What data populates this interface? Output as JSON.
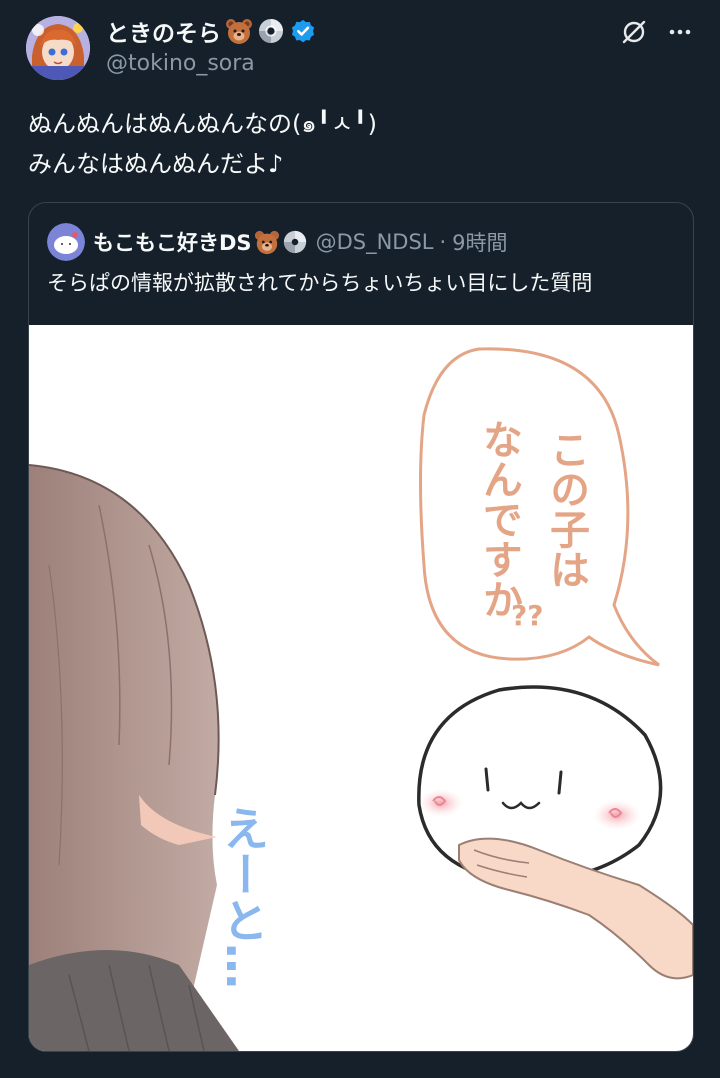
{
  "author": {
    "display_name": "ときのそら",
    "username": "@tokino_sora",
    "avatar_icon": "user-avatar",
    "badges": [
      "bear-emoji-icon",
      "disc-emoji-icon",
      "verified-badge-icon"
    ]
  },
  "header_actions": {
    "grok_icon": "grok-icon",
    "more_icon": "more-options-icon"
  },
  "tweet": {
    "lines": [
      "ぬんぬんはぬんぬんなの(๑╹ㅅ╹)",
      "みんなはぬんぬんだよ♪"
    ]
  },
  "quote": {
    "display_name": "もこもこ好きDS",
    "username": "@DS_NDSL",
    "separator": "·",
    "time": "9時間",
    "text": "そらぱの情報が拡散されてからちょいちょい目にした質問",
    "image": {
      "bubble_text": [
        "この子は",
        "なんですか",
        "??"
      ],
      "side_text": "えーと…"
    }
  },
  "colors": {
    "background": "#15202b",
    "text": "#f7f9f9",
    "secondary_text": "#8b98a5",
    "border": "#38444d",
    "verified": "#1d9bf0",
    "bubble_stroke": "#e4a587",
    "side_text": "#8ab8ee"
  }
}
